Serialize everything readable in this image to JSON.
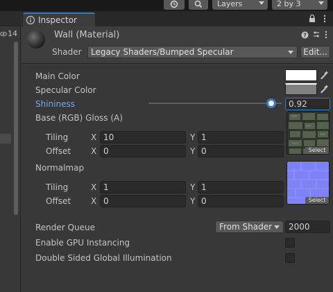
{
  "toolbar": {
    "history_icon": "history-icon",
    "search_icon": "search-icon",
    "layers_label": "Layers",
    "layout_label": "2 by 3"
  },
  "left_panel": {
    "visibility_count": "14"
  },
  "inspector": {
    "tab_label": "Inspector",
    "tab_icon": "info-icon",
    "material_title": "Wall (Material)",
    "shader_label": "Shader",
    "shader_value": "Legacy Shaders/Bumped Specular",
    "edit_button": "Edit...",
    "properties": {
      "main_color_label": "Main Color",
      "main_color": "#ffffff",
      "specular_color_label": "Specular Color",
      "specular_color": "#808080",
      "shininess_label": "Shininess",
      "shininess_value": "0.92",
      "shininess_fraction": 0.92,
      "base_label": "Base (RGB) Gloss (A)",
      "base": {
        "tiling_label": "Tiling",
        "offset_label": "Offset",
        "x_label": "X",
        "y_label": "Y",
        "tiling_x": "10",
        "tiling_y": "1",
        "offset_x": "0",
        "offset_y": "0"
      },
      "normalmap_label": "Normalmap",
      "normalmap": {
        "tiling_label": "Tiling",
        "offset_label": "Offset",
        "x_label": "X",
        "y_label": "Y",
        "tiling_x": "1",
        "tiling_y": "1",
        "offset_x": "0",
        "offset_y": "0"
      },
      "select_label": "Select",
      "render_queue_label": "Render Queue",
      "render_queue_mode": "From Shader",
      "render_queue_value": "2000",
      "gpu_instancing_label": "Enable GPU Instancing",
      "gpu_instancing_checked": false,
      "double_sided_gi_label": "Double Sided Global Illumination",
      "double_sided_gi_checked": false
    }
  },
  "colors": {
    "accent_blue": "#3a79bb",
    "shininess_label_blue": "#7ba7e6",
    "panel_bg": "#383838",
    "field_bg": "#2a2a2a"
  }
}
